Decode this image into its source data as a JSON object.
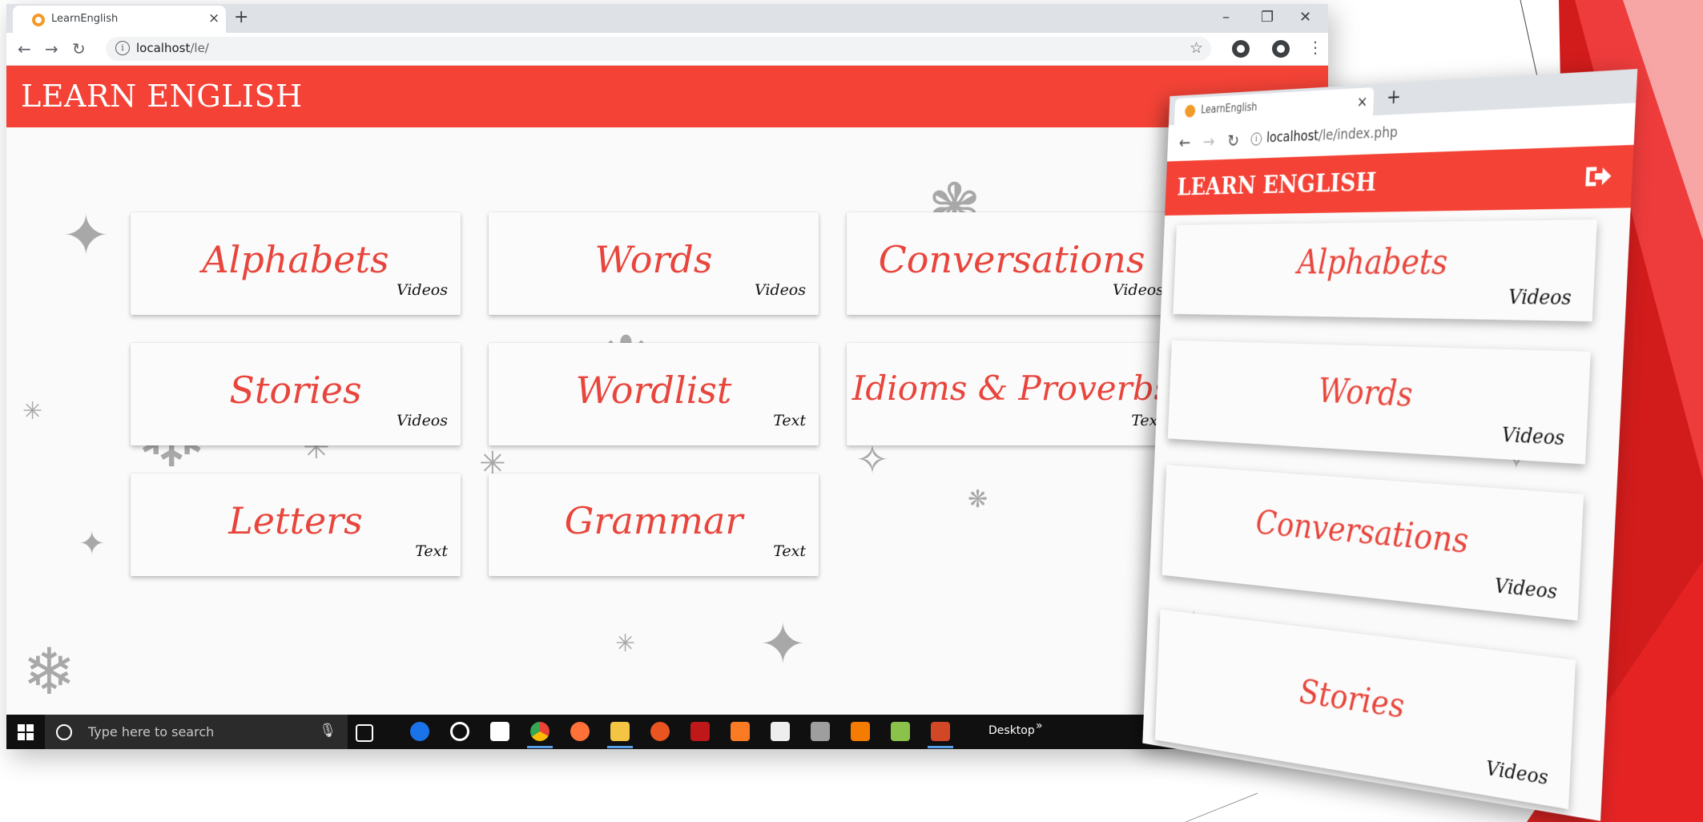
{
  "desktop": {
    "tab_title": "LearnEnglish",
    "tab_close": "×",
    "new_tab": "+",
    "window_controls": {
      "minimize": "–",
      "restore": "❐",
      "close": "✕"
    },
    "url_host": "localhost",
    "url_path": "/le/",
    "brand": "LEARN ENGLISH",
    "cards": [
      {
        "title": "Alphabets",
        "type": "Videos"
      },
      {
        "title": "Words",
        "type": "Videos"
      },
      {
        "title": "Conversations",
        "type": "Videos"
      },
      {
        "title": "Stories",
        "type": "Videos"
      },
      {
        "title": "Wordlist",
        "type": "Text"
      },
      {
        "title": "Idioms & Proverbs",
        "type": "Text"
      },
      {
        "title": "Letters",
        "type": "Text"
      },
      {
        "title": "Grammar",
        "type": "Text"
      }
    ],
    "taskbar": {
      "search_placeholder": "Type here to search",
      "desktop_label": "Desktop",
      "overflow": "»",
      "icons": [
        "task-view-icon",
        "edge-icon",
        "groove-icon",
        "store-icon",
        "chrome-icon",
        "firefox-icon",
        "file-explorer-icon",
        "ubuntu-icon",
        "mcafee-icon",
        "xampp-icon",
        "mail-icon",
        "calculator-icon",
        "g-app-icon",
        "notepad-icon",
        "powerpoint-icon"
      ]
    }
  },
  "mobile": {
    "tab_title": "LearnEnglish",
    "tab_close": "×",
    "new_tab": "+",
    "url_host": "localhost",
    "url_path": "/le/index.php",
    "brand": "LEARN ENGLISH",
    "cards": [
      {
        "title": "Alphabets",
        "type": "Videos"
      },
      {
        "title": "Words",
        "type": "Videos"
      },
      {
        "title": "Conversations",
        "type": "Videos"
      },
      {
        "title": "Stories",
        "type": "Videos"
      }
    ]
  },
  "colors": {
    "brand_red": "#f44236",
    "card_title_red": "#e8453c",
    "taskbar_bg": "#101010"
  }
}
